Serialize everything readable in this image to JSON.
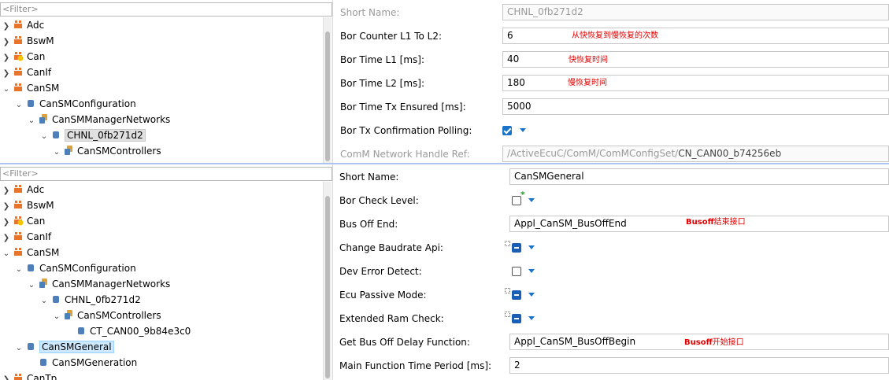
{
  "top_tree": {
    "filter_placeholder": "<Filter>",
    "nodes": [
      "Adc",
      "BswM",
      "Can",
      "CanIf",
      "CanSM",
      "CanSMConfiguration",
      "CanSMManagerNetworks",
      "CHNL_0fb271d2",
      "CanSMControllers"
    ]
  },
  "top_form": {
    "rows": [
      {
        "label": "Short Name:",
        "value": "CHNL_0fb271d2",
        "note": ""
      },
      {
        "label": "Bor Counter L1 To L2:",
        "value": "6",
        "note": "从快恢复到慢恢复的次数"
      },
      {
        "label": "Bor Time L1 [ms]:",
        "value": "40",
        "note": "快恢复时间"
      },
      {
        "label": "Bor Time L2 [ms]:",
        "value": "180",
        "note": "慢恢复时间"
      },
      {
        "label": "Bor Time Tx Ensured [ms]:",
        "value": "5000",
        "note": ""
      },
      {
        "label": "Bor Tx Confirmation Polling:",
        "value": "",
        "note": ""
      },
      {
        "label": "ComM Network Handle Ref:",
        "value_prefix": "/ActiveEcuC/ComM/ComMConfigSet/",
        "value": "CN_CAN00_b74256eb",
        "note": ""
      }
    ]
  },
  "bottom_tree": {
    "filter_placeholder": "<Filter>",
    "nodes": [
      "Adc",
      "BswM",
      "Can",
      "CanIf",
      "CanSM",
      "CanSMConfiguration",
      "CanSMManagerNetworks",
      "CHNL_0fb271d2",
      "CanSMControllers",
      "CT_CAN00_9b84e3c0",
      "CanSMGeneral",
      "CanSMGeneration",
      "CanTp"
    ]
  },
  "bottom_form": {
    "rows": [
      {
        "label": "Short Name:",
        "value": "CanSMGeneral"
      },
      {
        "label": "Bor Check Level:",
        "value": ""
      },
      {
        "label": "Bus Off End:",
        "value": "Appl_CanSM_BusOffEnd",
        "note_bold": "Busoff",
        "note": "结束接口"
      },
      {
        "label": "Change Baudrate Api:",
        "value": ""
      },
      {
        "label": "Dev Error Detect:",
        "value": ""
      },
      {
        "label": "Ecu Passive Mode:",
        "value": ""
      },
      {
        "label": "Extended Ram Check:",
        "value": ""
      },
      {
        "label": "Get Bus Off Delay Function:",
        "value": "Appl_CanSM_BusOffBegin",
        "note_bold": "Busoff",
        "note": "开始接口"
      },
      {
        "label": "Main Function Time Period [ms]:",
        "value": "2"
      }
    ]
  },
  "colors": {
    "accent": "#1a73c8",
    "annotation": "#e00000",
    "selection": "#cce8ff",
    "splitter": "#aac6ee"
  }
}
